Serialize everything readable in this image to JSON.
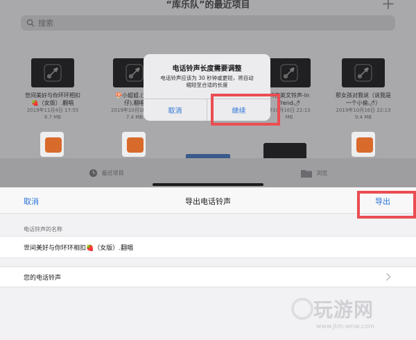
{
  "browser": {
    "title": "“库乐队”的最近项目",
    "plus": "+",
    "search_placeholder": "搜索",
    "files": [
      {
        "name1": "世间美好与你环环相扣",
        "name2": "🍓（女版）.翻唱",
        "date": "2019年11月4日 17:55",
        "size": "8.7 MB"
      },
      {
        "name1": "🍄小姐姐.(大田",
        "name2": "仔).翻唱",
        "date": "2019年10月16日 22",
        "size": "7.4 MB"
      },
      {
        "name1": "抖音英文铃声-In",
        "name2": "Trend🌶",
        "date": "年10月16日 22:13",
        "size": "MB"
      },
      {
        "name1": "那女孩对我说（说我是",
        "name2": "一个小偷🌶）",
        "date": "2019年10月16日 22:13",
        "size": "9.4 MB"
      }
    ],
    "tabs": [
      {
        "label": "最近项目",
        "icon": "clock-icon"
      },
      {
        "label": "浏览",
        "icon": "folder-icon"
      }
    ]
  },
  "alert": {
    "title": "电话铃声长度需要调整",
    "message_line1": "电话铃声应该为 30 秒钟或更短，将自动",
    "message_line2": "缩短至合适的长度",
    "cancel_label": "取消",
    "continue_label": "继续"
  },
  "sheet": {
    "cancel_label": "取消",
    "title": "导出电话铃声",
    "export_label": "导出",
    "name_section_label": "电话铃声的名称",
    "name_value": "世间美好与你环环相扣🍓（女版）.翻唱",
    "ringtone_label": "您的电话铃声"
  },
  "watermark": {
    "text": "玩游网",
    "url": "www.jtm-wnw.com"
  },
  "colors": {
    "accent": "#2a72d6",
    "highlight": "#ea4d52",
    "dim_background": "#a9a9ab"
  }
}
